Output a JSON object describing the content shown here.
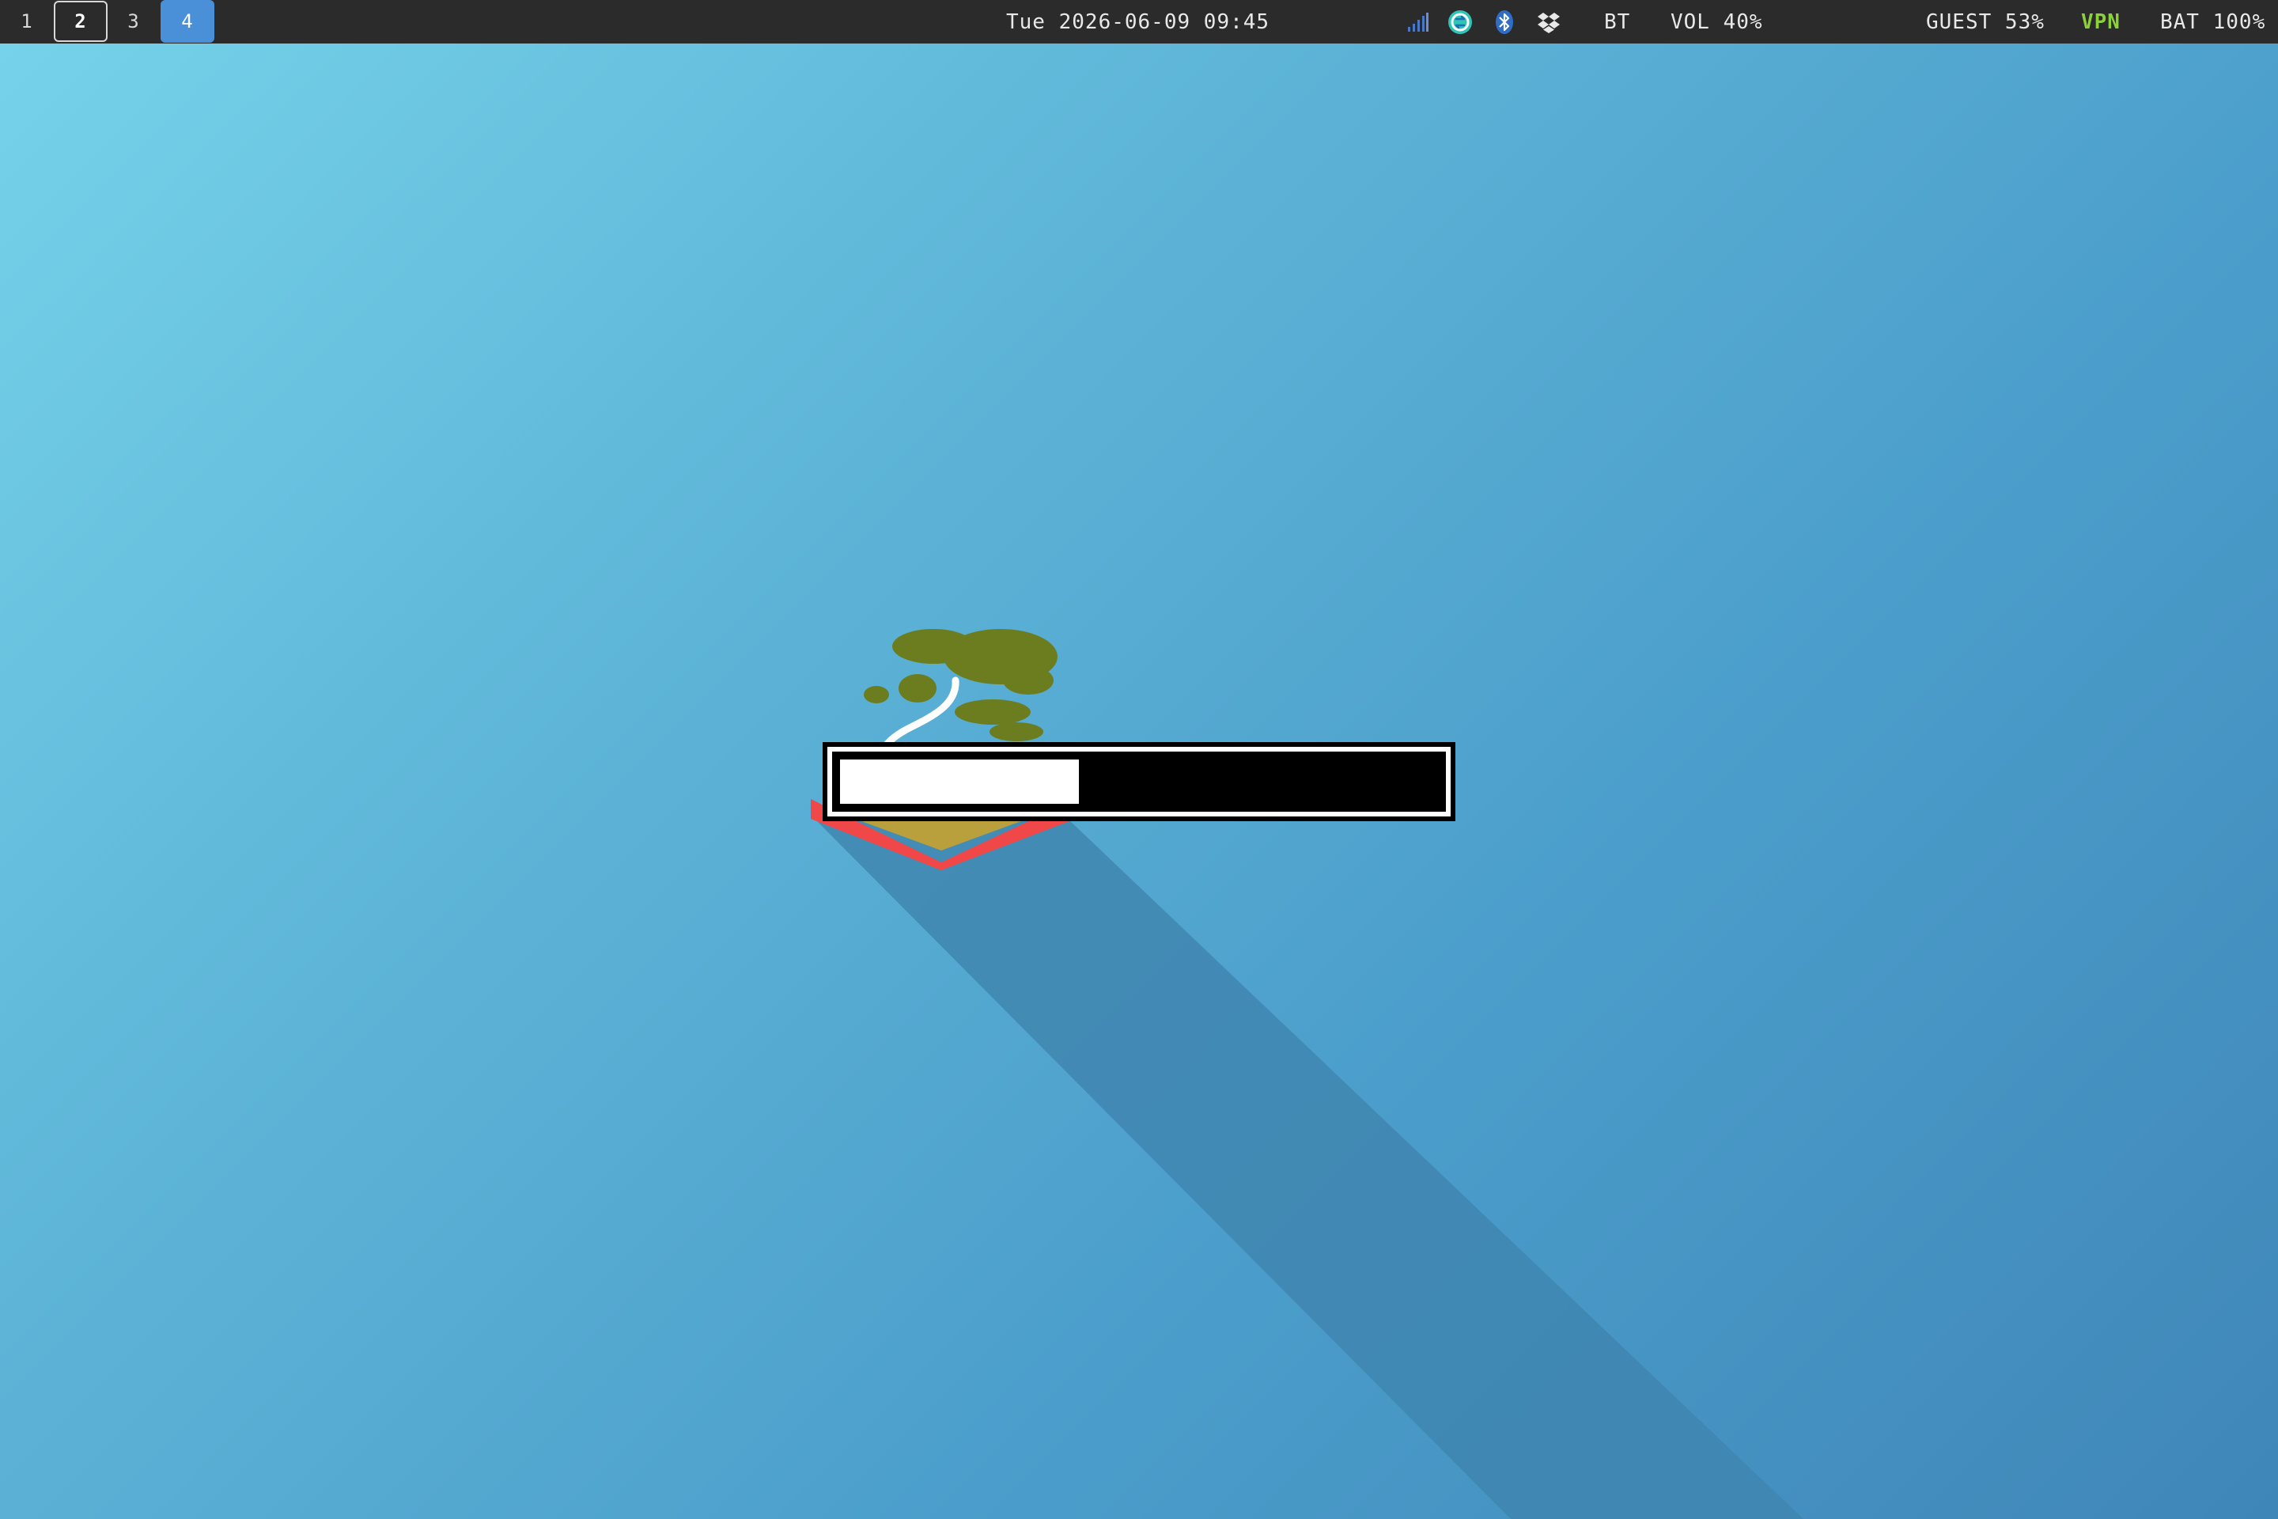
{
  "workspaces": [
    {
      "label": "1",
      "state": "normal"
    },
    {
      "label": "2",
      "state": "focused"
    },
    {
      "label": "3",
      "state": "normal"
    },
    {
      "label": "4",
      "state": "urgent"
    }
  ],
  "clock": "Tue 2026-06-09  09:45",
  "tray": {
    "icons": [
      "signal-icon",
      "sync-icon",
      "bluetooth-icon",
      "dropbox-icon"
    ]
  },
  "status": {
    "bt": "BT",
    "volume": "VOL 40%",
    "guest": "GUEST 53%",
    "vpn": "VPN",
    "battery": "BAT 100%"
  },
  "colors": {
    "bar_background": "#2b2b2b",
    "urgent_workspace": "#4a90d9",
    "vpn_text": "#8bd13a",
    "wallpaper_light": "#76d3ea",
    "wallpaper_dark": "#3f86b8"
  },
  "osd": {
    "level": 0.4
  }
}
